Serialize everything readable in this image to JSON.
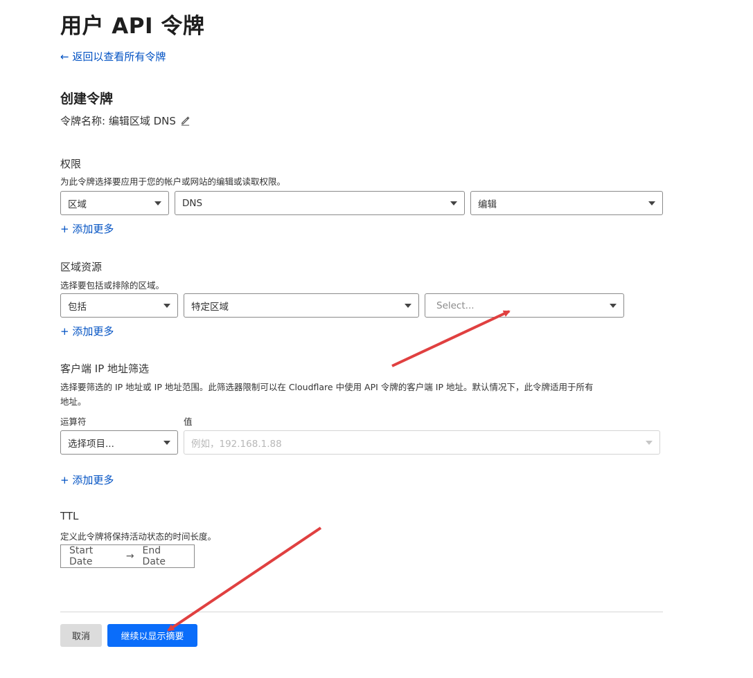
{
  "page_title": "用户 API 令牌",
  "back_link": "← 返回以查看所有令牌",
  "section_title": "创建令牌",
  "token_name": "令牌名称: 编辑区域 DNS",
  "permissions": {
    "title": "权限",
    "description": "为此令牌选择要应用于您的帐户或网站的编辑或读取权限。",
    "selects": [
      "区域",
      "DNS",
      "编辑"
    ],
    "add_more": "+ 添加更多"
  },
  "zone_resources": {
    "title": "区域资源",
    "description": "选择要包括或排除的区域。",
    "selects": [
      "包括",
      "特定区域"
    ],
    "zone_placeholder": "Select...",
    "add_more": "+ 添加更多"
  },
  "client_ip": {
    "title": "客户端 IP 地址筛选",
    "description_line1": "选择要筛选的 IP 地址或 IP 地址范围。此筛选器限制可以在 Cloudflare 中使用 API 令牌的客户端 IP 地址。默认情况下，此令牌适用于所有",
    "description_line2": "地址。",
    "operator_label": "运算符",
    "value_label": "值",
    "operator_select": "选择项目...",
    "value_placeholder": "例如，192.168.1.88",
    "add_more": "+ 添加更多"
  },
  "ttl": {
    "title": "TTL",
    "description": "定义此令牌将保持活动状态的时间长度。",
    "start_date": "Start Date",
    "arrow": "→",
    "end_date": "End Date"
  },
  "buttons": {
    "cancel": "取消",
    "continue": "继续以显示摘要"
  },
  "colors": {
    "link": "#0051c3",
    "primary": "#0a6dfa",
    "annotation_arrow": "#e04040"
  },
  "icons": [
    "arrow-left-icon",
    "pencil-icon",
    "caret-down-icon",
    "arrow-right-icon"
  ]
}
